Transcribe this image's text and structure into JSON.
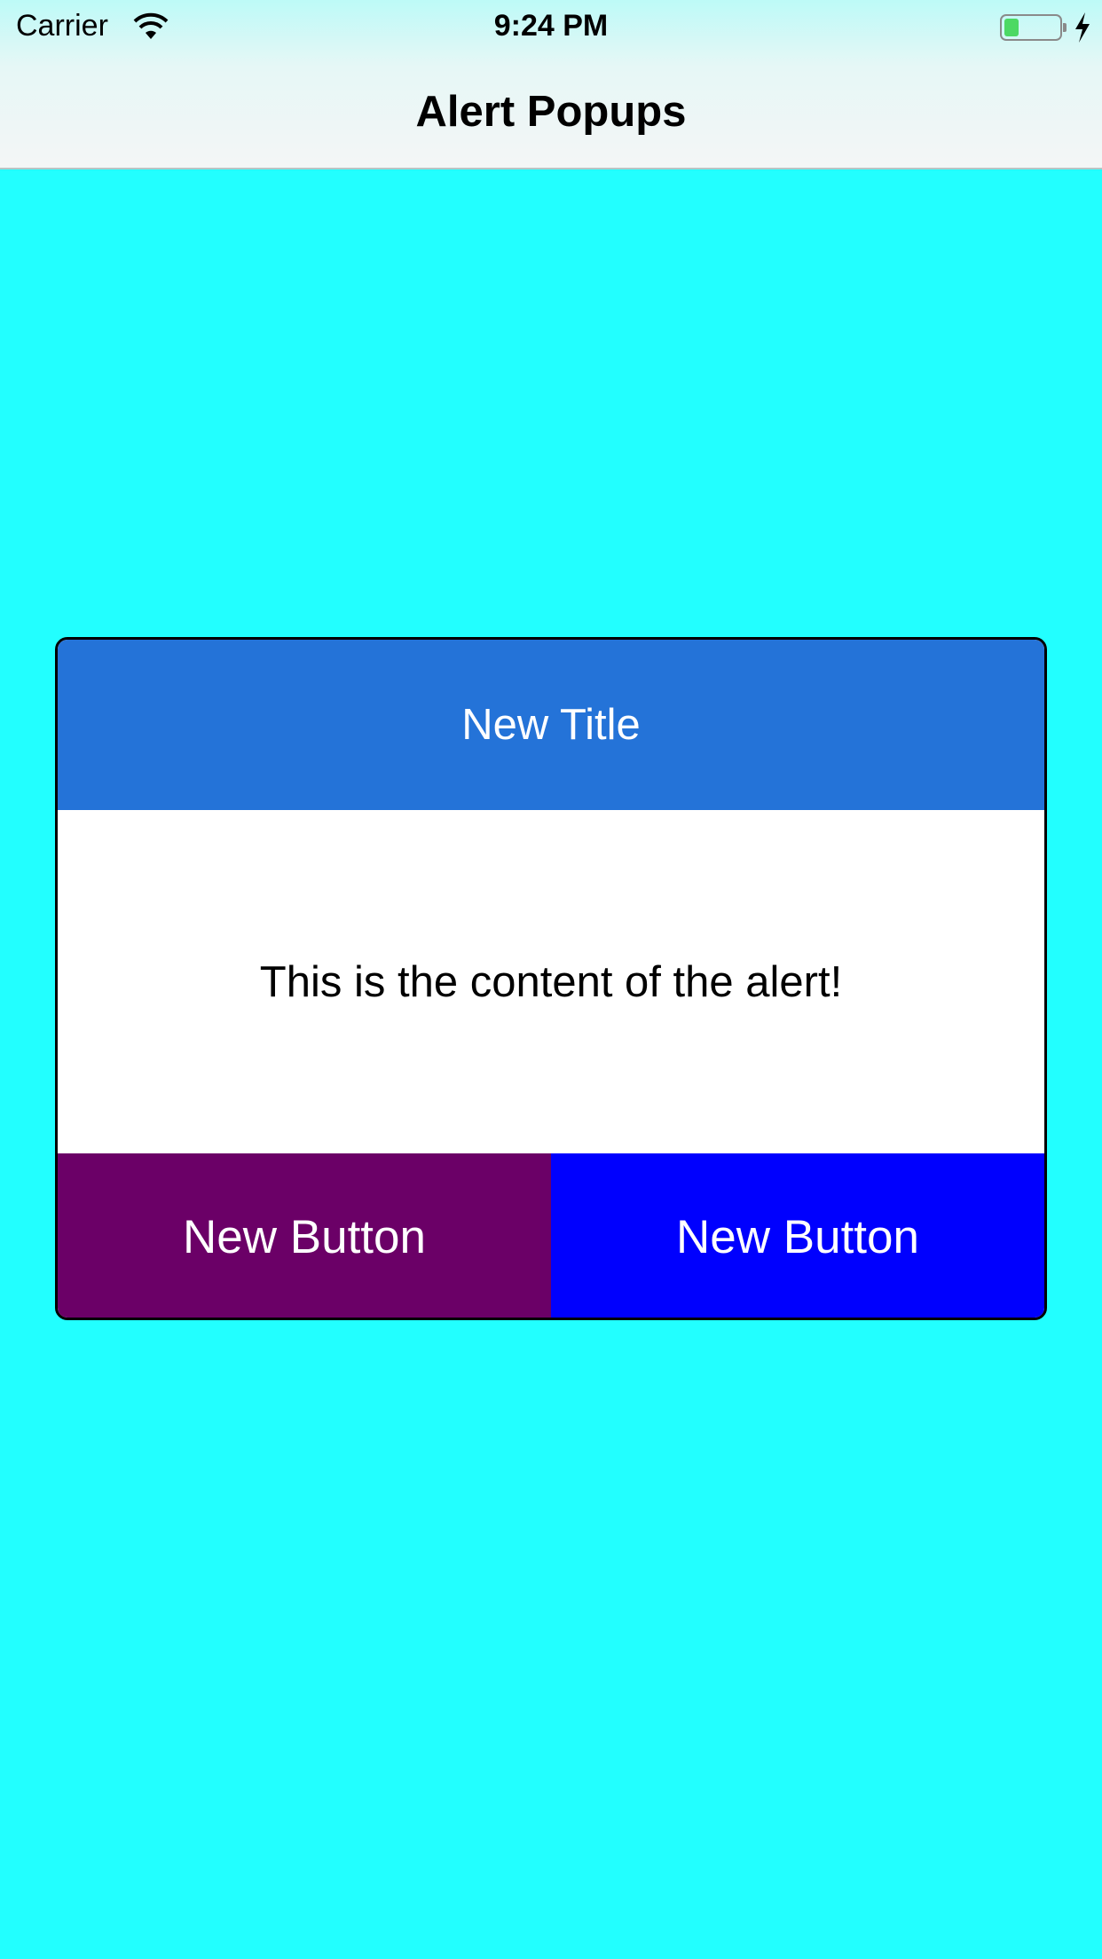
{
  "status_bar": {
    "carrier": "Carrier",
    "time": "9:24 PM",
    "wifi_icon": "wifi-icon",
    "battery_icon": "battery-icon",
    "charging_icon": "charging-bolt-icon"
  },
  "nav": {
    "title": "Alert Popups"
  },
  "alert": {
    "title": "New Title",
    "content": "This is the content of the alert!",
    "buttons": [
      {
        "label": "New Button",
        "color": "#6b0067"
      },
      {
        "label": "New Button",
        "color": "#0000fe"
      }
    ],
    "title_color": "#2473d8"
  },
  "colors": {
    "background": "#22ffff"
  }
}
